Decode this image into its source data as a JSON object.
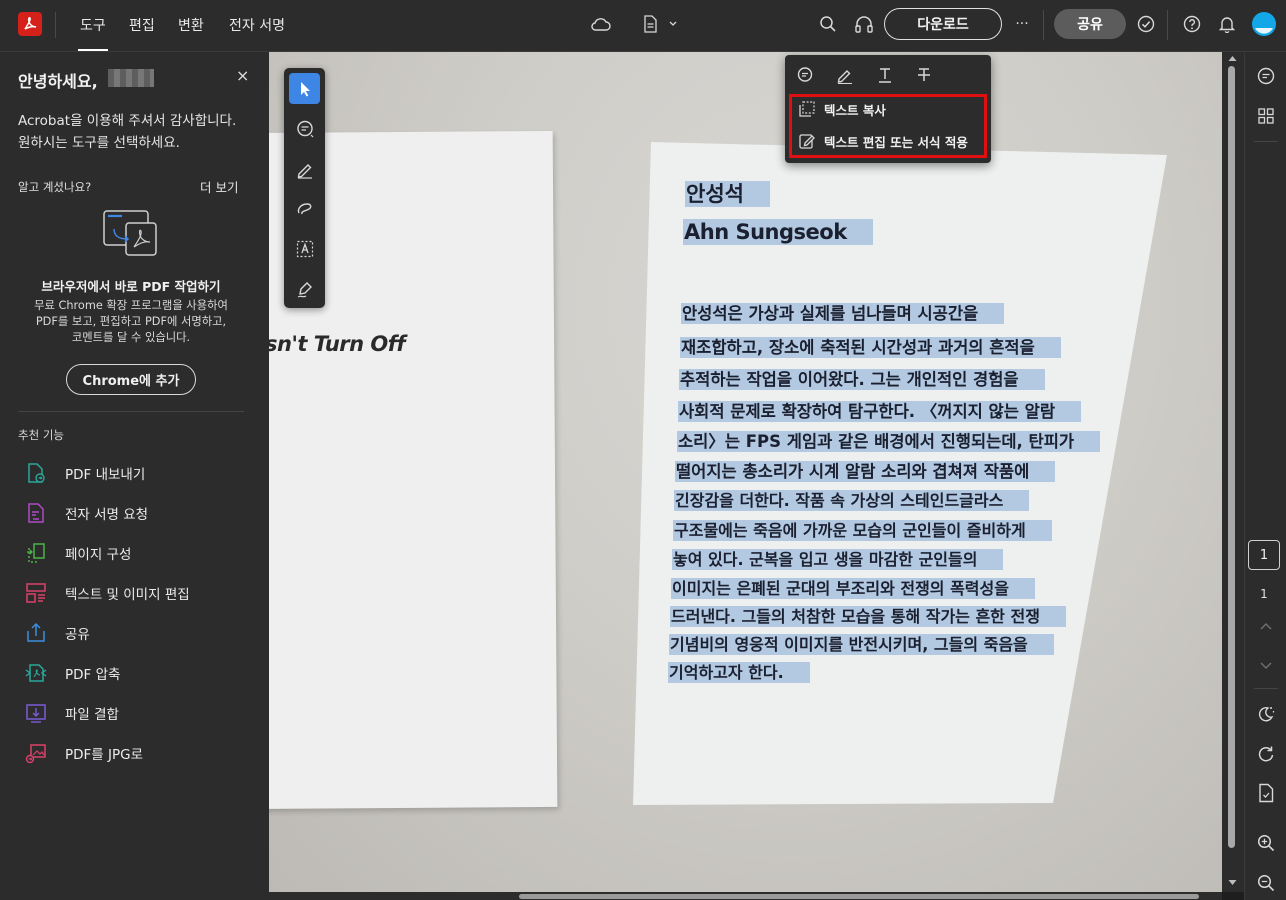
{
  "topbar": {
    "tabs": [
      {
        "label": "도구",
        "active": true
      },
      {
        "label": "편집",
        "active": false
      },
      {
        "label": "변환",
        "active": false
      },
      {
        "label": "전자 서명",
        "active": false
      }
    ],
    "download_label": "다운로드",
    "more_label": "···",
    "share_label": "공유"
  },
  "left_panel": {
    "greeting": "안녕하세요,",
    "close_label": "×",
    "thanks_line1": "Acrobat을 이용해 주셔서 감사합니다.",
    "thanks_line2": "원하시는 도구를 선택하세요.",
    "did_you_know": "알고 계셨나요?",
    "see_more": "더 보기",
    "promo_title": "브라우저에서 바로 PDF 작업하기",
    "promo_desc_line1": "무료 Chrome 확장 프로그램을 사용하여",
    "promo_desc_line2": "PDF를 보고, 편집하고 PDF에 서명하고,",
    "promo_desc_line3": "코멘트를 달 수 있습니다.",
    "chrome_button": "Chrome에 추가",
    "recommended_title": "추천 기능",
    "tools": [
      {
        "label": "PDF 내보내기",
        "icon": "export-pdf-icon",
        "color": "#2aa89a"
      },
      {
        "label": "전자 서명 요청",
        "icon": "request-signature-icon",
        "color": "#b04bc8"
      },
      {
        "label": "페이지 구성",
        "icon": "organize-pages-icon",
        "color": "#4ab34a"
      },
      {
        "label": "텍스트 및 이미지 편집",
        "icon": "edit-text-image-icon",
        "color": "#d9426a"
      },
      {
        "label": "공유",
        "icon": "share-icon",
        "color": "#3b8ee0"
      },
      {
        "label": "PDF 압축",
        "icon": "compress-pdf-icon",
        "color": "#2aa89a"
      },
      {
        "label": "파일 결합",
        "icon": "combine-files-icon",
        "color": "#7b5bd6"
      },
      {
        "label": "PDF를 JPG로",
        "icon": "pdf-to-jpg-icon",
        "color": "#d9426a"
      }
    ]
  },
  "context_menu": {
    "copy_text": "텍스트 복사",
    "edit_text": "텍스트 편집 또는 서식 적용"
  },
  "document": {
    "left_paper_text": "sn't Turn Off",
    "title_ko": "안성석",
    "title_en": "Ahn Sungseok",
    "body_lines": [
      "안성석은 가상과 실제를 넘나들며 시공간을",
      "재조합하고, 장소에 축적된 시간성과 과거의 흔적을",
      "추적하는 작업을 이어왔다. 그는 개인적인 경험을",
      "사회적 문제로 확장하여 탐구한다. 〈꺼지지 않는 알람",
      "소리〉는 FPS 게임과 같은 배경에서 진행되는데, 탄피가",
      "떨어지는 총소리가 시계 알람 소리와 겹쳐져 작품에",
      "긴장감을 더한다. 작품 속 가상의 스테인드글라스",
      "구조물에는 죽음에 가까운 모습의 군인들이 즐비하게",
      "놓여 있다. 군복을 입고 생을 마감한 군인들의",
      "이미지는 은폐된 군대의 부조리와 전쟁의 폭력성을",
      "드러낸다. 그들의 처참한 모습을 통해 작가는 흔한 전쟁",
      "기념비의 영웅적 이미지를 반전시키며, 그들의 죽음을",
      "기억하고자 한다."
    ]
  },
  "page_nav": {
    "current": "1",
    "total": "1"
  },
  "colors": {
    "accent_blue": "#3e86e6",
    "highlight_red": "#e01010",
    "selection": "#84aad6"
  }
}
